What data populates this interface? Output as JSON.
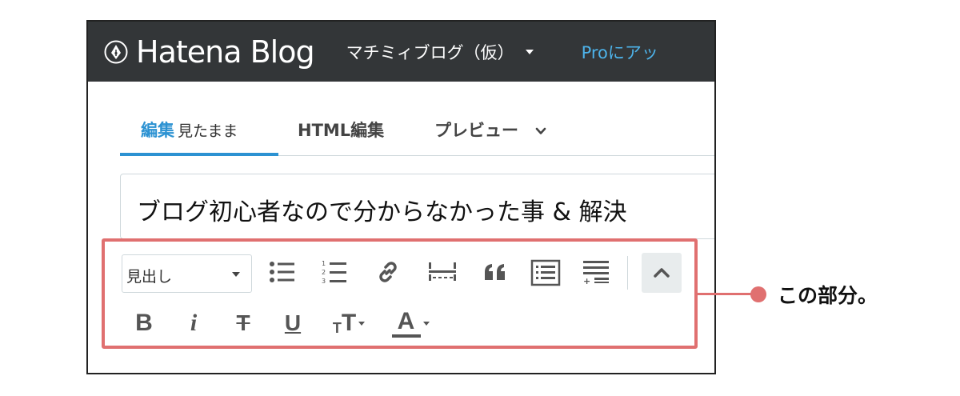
{
  "header": {
    "brand": "Hatena Blog",
    "blog_name": "マチミィブログ（仮）",
    "pro_link": "Proにアッ"
  },
  "tabs": [
    {
      "label": "編集",
      "sublabel": "見たまま",
      "active": true
    },
    {
      "label": "HTML編集"
    },
    {
      "label": "プレビュー"
    }
  ],
  "editor": {
    "title_value": "ブログ初心者なので分からなかった事 & 解決"
  },
  "toolbar": {
    "heading_select": "見出し",
    "row1_icons": [
      "bulleted-list-icon",
      "numbered-list-icon",
      "link-icon",
      "more-separator-icon",
      "quote-icon",
      "table-of-contents-icon",
      "footnote-icon",
      "collapse-chevron-up-icon"
    ],
    "row2_icons": [
      "bold-icon",
      "italic-icon",
      "strikethrough-icon",
      "underline-icon",
      "text-size-icon",
      "text-color-icon"
    ],
    "bold": "B",
    "italic": "i",
    "strike": "T",
    "underline": "U",
    "size_small": "T",
    "size_large": "T",
    "color": "A"
  },
  "annotation": {
    "label": "この部分。",
    "color": "#e07070"
  },
  "colors": {
    "header_bg": "#333638",
    "accent": "#2c92d2",
    "pro_link": "#4db3ea"
  }
}
